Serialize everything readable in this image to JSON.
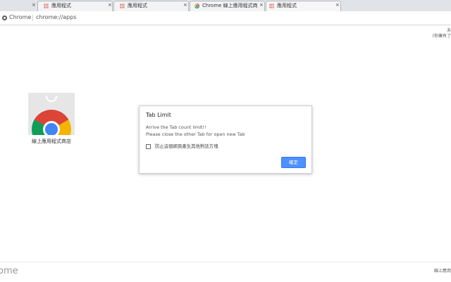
{
  "tabs": [
    {
      "title": "",
      "icon": "grid",
      "active": false
    },
    {
      "title": "應用程式",
      "icon": "grid",
      "active": false
    },
    {
      "title": "應用程式",
      "icon": "grid",
      "active": false
    },
    {
      "title": "Chrome 線上應用程式商店",
      "icon": "chrome",
      "active": false
    },
    {
      "title": "應用程式",
      "icon": "grid",
      "active": true
    }
  ],
  "close_symbol": "×",
  "omnibox": {
    "label": "Chrome",
    "url": "chrome://apps"
  },
  "corner_top": {
    "line1": "未",
    "line2": "(你擁有了"
  },
  "app": {
    "name": "線上應用程式商店"
  },
  "dialog": {
    "title": "Tab Limit",
    "message_line1": "Arrive the Tab count limit!!",
    "message_line2": "Please close the other Tab for open new Tab",
    "checkbox_label": "防止這個網頁產生其他對話方塊",
    "ok_label": "確定"
  },
  "bottom": {
    "left_text": "ome",
    "right_text": "線上應用"
  },
  "colors": {
    "accent": "#4d90fe",
    "tabstrip": "#e0e3e7"
  }
}
